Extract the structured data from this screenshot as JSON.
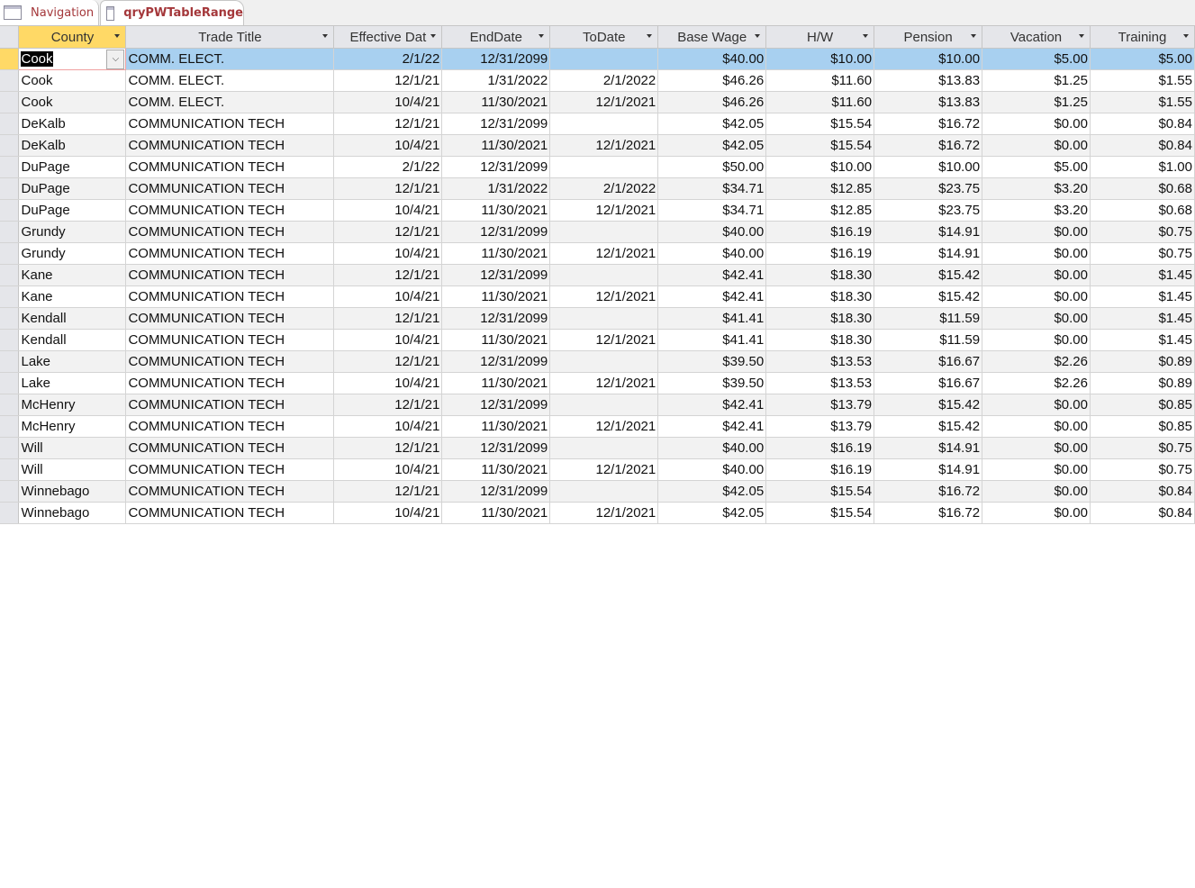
{
  "tabs": [
    {
      "label": "Navigation",
      "icon": "form-icon"
    },
    {
      "label": "qryPWTableRange",
      "icon": "query-icon"
    }
  ],
  "columns": [
    "County",
    "Trade Title",
    "Effective Dat",
    "EndDate",
    "ToDate",
    "Base Wage",
    "H/W",
    "Pension",
    "Vacation",
    "Training"
  ],
  "rows": [
    [
      "Cook",
      "COMM. ELECT.",
      "2/1/22",
      "12/31/2099",
      "",
      "$40.00",
      "$10.00",
      "$10.00",
      "$5.00",
      "$5.00"
    ],
    [
      "Cook",
      "COMM. ELECT.",
      "12/1/21",
      "1/31/2022",
      "2/1/2022",
      "$46.26",
      "$11.60",
      "$13.83",
      "$1.25",
      "$1.55"
    ],
    [
      "Cook",
      "COMM. ELECT.",
      "10/4/21",
      "11/30/2021",
      "12/1/2021",
      "$46.26",
      "$11.60",
      "$13.83",
      "$1.25",
      "$1.55"
    ],
    [
      "DeKalb",
      "COMMUNICATION TECH",
      "12/1/21",
      "12/31/2099",
      "",
      "$42.05",
      "$15.54",
      "$16.72",
      "$0.00",
      "$0.84"
    ],
    [
      "DeKalb",
      "COMMUNICATION TECH",
      "10/4/21",
      "11/30/2021",
      "12/1/2021",
      "$42.05",
      "$15.54",
      "$16.72",
      "$0.00",
      "$0.84"
    ],
    [
      "DuPage",
      "COMMUNICATION TECH",
      "2/1/22",
      "12/31/2099",
      "",
      "$50.00",
      "$10.00",
      "$10.00",
      "$5.00",
      "$1.00"
    ],
    [
      "DuPage",
      "COMMUNICATION TECH",
      "12/1/21",
      "1/31/2022",
      "2/1/2022",
      "$34.71",
      "$12.85",
      "$23.75",
      "$3.20",
      "$0.68"
    ],
    [
      "DuPage",
      "COMMUNICATION TECH",
      "10/4/21",
      "11/30/2021",
      "12/1/2021",
      "$34.71",
      "$12.85",
      "$23.75",
      "$3.20",
      "$0.68"
    ],
    [
      "Grundy",
      "COMMUNICATION TECH",
      "12/1/21",
      "12/31/2099",
      "",
      "$40.00",
      "$16.19",
      "$14.91",
      "$0.00",
      "$0.75"
    ],
    [
      "Grundy",
      "COMMUNICATION TECH",
      "10/4/21",
      "11/30/2021",
      "12/1/2021",
      "$40.00",
      "$16.19",
      "$14.91",
      "$0.00",
      "$0.75"
    ],
    [
      "Kane",
      "COMMUNICATION TECH",
      "12/1/21",
      "12/31/2099",
      "",
      "$42.41",
      "$18.30",
      "$15.42",
      "$0.00",
      "$1.45"
    ],
    [
      "Kane",
      "COMMUNICATION TECH",
      "10/4/21",
      "11/30/2021",
      "12/1/2021",
      "$42.41",
      "$18.30",
      "$15.42",
      "$0.00",
      "$1.45"
    ],
    [
      "Kendall",
      "COMMUNICATION TECH",
      "12/1/21",
      "12/31/2099",
      "",
      "$41.41",
      "$18.30",
      "$11.59",
      "$0.00",
      "$1.45"
    ],
    [
      "Kendall",
      "COMMUNICATION TECH",
      "10/4/21",
      "11/30/2021",
      "12/1/2021",
      "$41.41",
      "$18.30",
      "$11.59",
      "$0.00",
      "$1.45"
    ],
    [
      "Lake",
      "COMMUNICATION TECH",
      "12/1/21",
      "12/31/2099",
      "",
      "$39.50",
      "$13.53",
      "$16.67",
      "$2.26",
      "$0.89"
    ],
    [
      "Lake",
      "COMMUNICATION TECH",
      "10/4/21",
      "11/30/2021",
      "12/1/2021",
      "$39.50",
      "$13.53",
      "$16.67",
      "$2.26",
      "$0.89"
    ],
    [
      "McHenry",
      "COMMUNICATION TECH",
      "12/1/21",
      "12/31/2099",
      "",
      "$42.41",
      "$13.79",
      "$15.42",
      "$0.00",
      "$0.85"
    ],
    [
      "McHenry",
      "COMMUNICATION TECH",
      "10/4/21",
      "11/30/2021",
      "12/1/2021",
      "$42.41",
      "$13.79",
      "$15.42",
      "$0.00",
      "$0.85"
    ],
    [
      "Will",
      "COMMUNICATION TECH",
      "12/1/21",
      "12/31/2099",
      "",
      "$40.00",
      "$16.19",
      "$14.91",
      "$0.00",
      "$0.75"
    ],
    [
      "Will",
      "COMMUNICATION TECH",
      "10/4/21",
      "11/30/2021",
      "12/1/2021",
      "$40.00",
      "$16.19",
      "$14.91",
      "$0.00",
      "$0.75"
    ],
    [
      "Winnebago",
      "COMMUNICATION TECH",
      "12/1/21",
      "12/31/2099",
      "",
      "$42.05",
      "$15.54",
      "$16.72",
      "$0.00",
      "$0.84"
    ],
    [
      "Winnebago",
      "COMMUNICATION TECH",
      "10/4/21",
      "11/30/2021",
      "12/1/2021",
      "$42.05",
      "$15.54",
      "$16.72",
      "$0.00",
      "$0.84"
    ]
  ]
}
